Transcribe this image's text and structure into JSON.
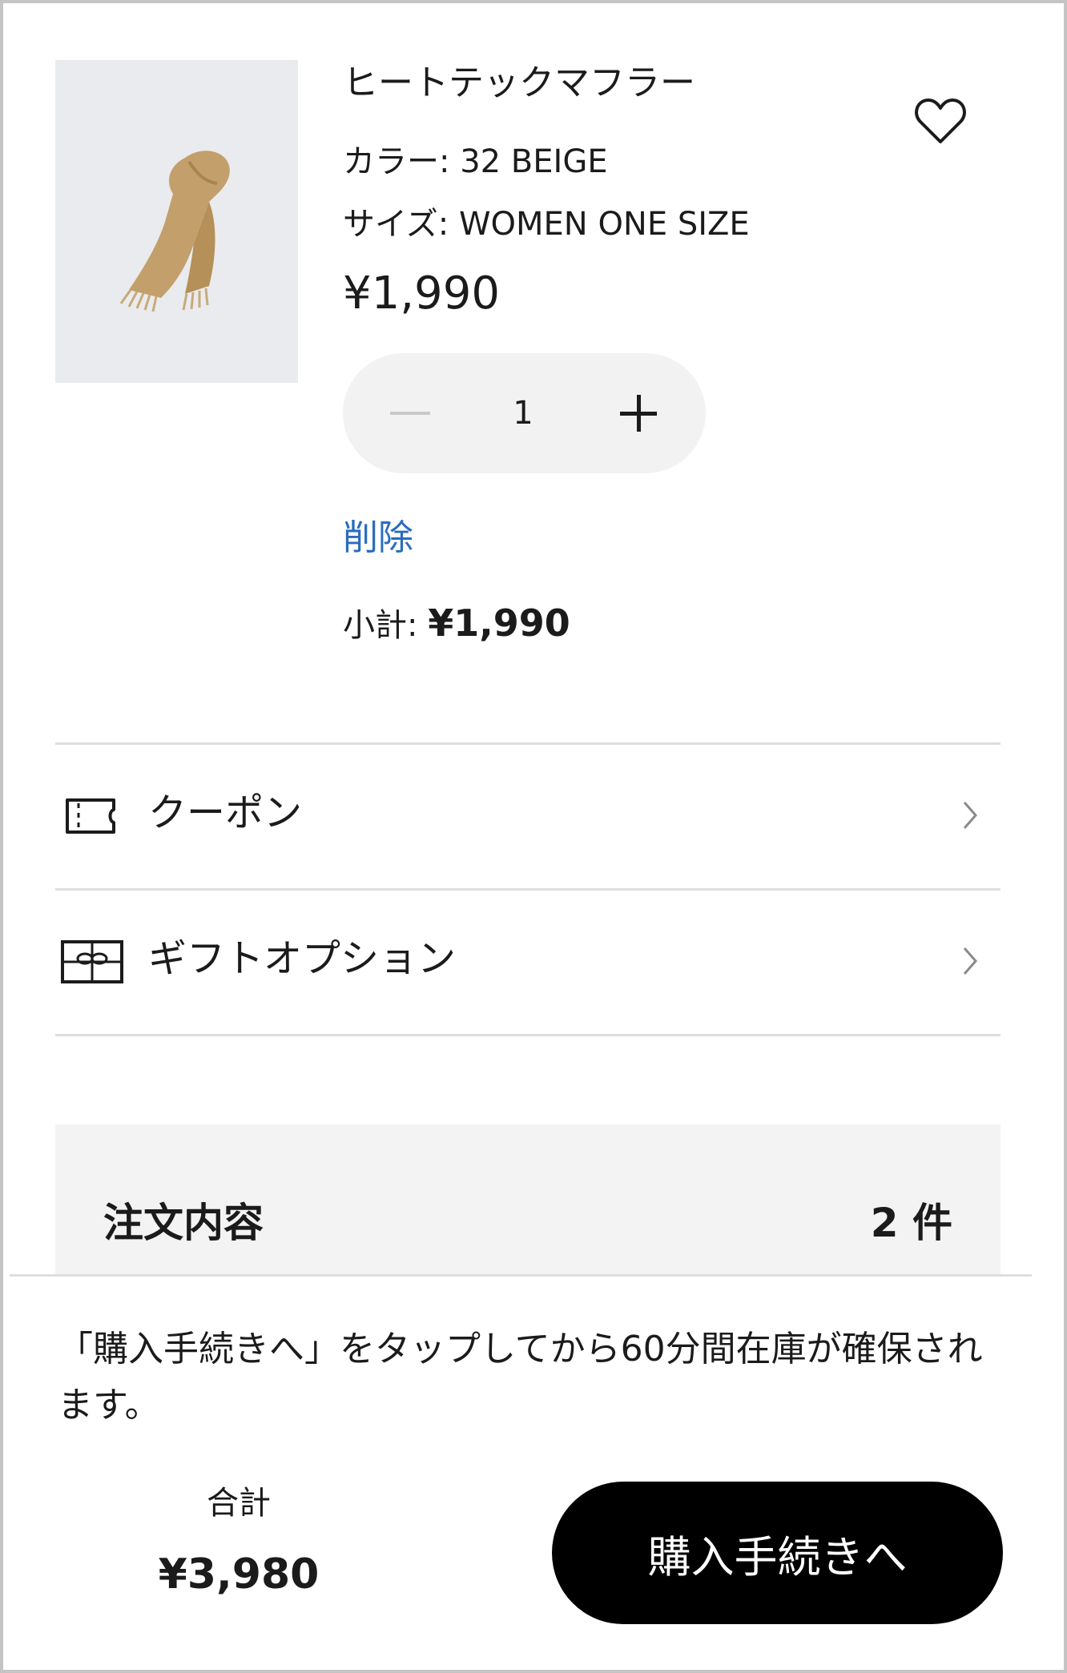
{
  "product": {
    "name": "ヒートテックマフラー",
    "color": "カラー: 32 BEIGE",
    "size": "サイズ: WOMEN ONE SIZE",
    "price": "¥1,990",
    "image_icon": "scarf-image",
    "quantity": "1",
    "delete_label": "削除",
    "subtotal_label": "小計:",
    "subtotal_value": "¥1,990"
  },
  "options": {
    "coupon_label": "クーポン",
    "gift_label": "ギフトオプション"
  },
  "summary": {
    "title": "注文内容",
    "count": "2 件"
  },
  "footer": {
    "notice": "「購入手続きへ」をタップしてから60分間在庫が確保されます。",
    "total_label": "合計",
    "total_value": "¥3,980",
    "checkout_label": "購入手続きへ"
  },
  "colors": {
    "link": "#2a6cbf",
    "button": "#000000",
    "summary_bg": "#f3f3f3",
    "stepper_bg": "#f2f2f2",
    "thumb_bg": "#e9ebee"
  }
}
